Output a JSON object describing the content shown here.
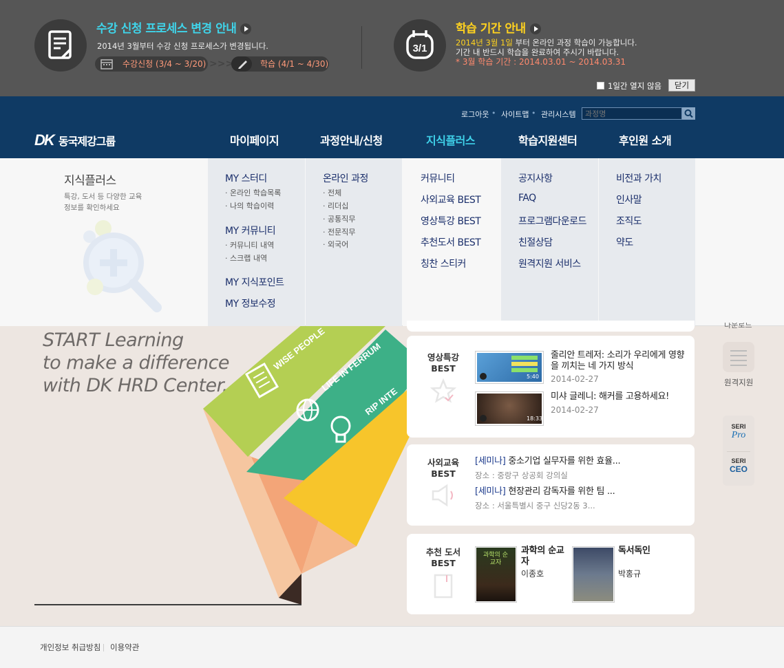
{
  "notice": {
    "left_title": "수강 신청 프로세스 변경 안내",
    "left_desc": "2014년 3월부터 수강 신청 프로세스가 변경됩니다.",
    "step1": "수강신청 (3/4 ~ 3/20)",
    "step2": "학습 (4/1 ~ 4/30)",
    "right_title": "학습 기간 안내",
    "right_highlight": "2014년 3월 1일",
    "right_desc1_rest": " 부터 온라인 과정 학습이 가능합니다.",
    "right_desc2": "기간 내 반드시 학습을 완료하여 주시기 바랍니다.",
    "right_period": "* 3월 학습 기간 : 2014.03.01 ~ 2014.03.31",
    "calendar_text": "3/1",
    "dismiss_label": "1일간 열지 않음",
    "close_label": "닫기"
  },
  "header": {
    "logo_mark": "DK",
    "logo_text": "동국제강그룹",
    "util": [
      "로그아웃",
      "사이트맵",
      "관리시스템"
    ],
    "search_placeholder": "과정명",
    "gnb": [
      "마이페이지",
      "과정안내/신청",
      "지식플러스",
      "학습지원센터",
      "후인원 소개"
    ],
    "active_index": 2
  },
  "mega": {
    "intro_title": "지식플러스",
    "intro_desc1": "특강, 도서 등 다양한 교육",
    "intro_desc2": "정보를 확인하세요",
    "col1": {
      "h1": "MY 스터디",
      "s1": [
        "온라인 학습목록",
        "나의 학습이력"
      ],
      "h2": "MY 커뮤니티",
      "s2": [
        "커뮤니티 내역",
        "스크랩 내역"
      ],
      "h3": "MY 지식포인트",
      "h4": "MY 정보수정"
    },
    "col2": {
      "h1": "온라인 과정",
      "s1": [
        "전체",
        "리더십",
        "공통직무",
        "전문직무",
        "외국어"
      ]
    },
    "col3": [
      "커뮤니티",
      "사외교육 BEST",
      "영상특강 BEST",
      "추천도서 BEST",
      "칭찬 스티커"
    ],
    "col4": [
      "공지사항",
      "FAQ",
      "프로그램다운로드",
      "친절상담",
      "원격지원 서비스"
    ],
    "col5": [
      "비전과 가치",
      "인사말",
      "조직도",
      "약도"
    ]
  },
  "hero": {
    "line1": "START Learning",
    "line2": "to make a difference",
    "line3": "with DK HRD Center.",
    "band1": "WISE PEOPLE",
    "band2": "LIFE IN FERRUM",
    "band3": "RIP INTE"
  },
  "video": {
    "label": "영상특강\nBEST",
    "items": [
      {
        "title": "줄리안 트레저: 소리가 우리에게 영향을 끼치는 네 가지 방식",
        "date": "2014-02-27",
        "duration": "5:40"
      },
      {
        "title": "미샤 글레니: 해커를 고용하세요!",
        "date": "2014-02-27",
        "duration": "18:33"
      }
    ]
  },
  "edu": {
    "label": "사외교육\nBEST",
    "items": [
      {
        "tag": "[세미나]",
        "title": " 중소기업 실무자를 위한 효율...",
        "place": "장소 : 중랑구 상공회 강의실"
      },
      {
        "tag": "[세미나]",
        "title": " 현장관리 감독자를 위한 팀 ...",
        "place": "장소 : 서울특별시 중구 신당2동 3..."
      }
    ]
  },
  "books": {
    "label": "추천 도서\nBEST",
    "items": [
      {
        "title": "과학의 순교자",
        "author": "이종호",
        "cover_text": "과학의 순교자"
      },
      {
        "title": "독서독인",
        "author": "박홍규"
      }
    ]
  },
  "side": {
    "remote_label": "원격지원",
    "top_label": "다운로드",
    "seri_pro": "Pro",
    "seri_ceo": "CEO",
    "seri": "SERI"
  },
  "footer": {
    "links": [
      "개인정보 취급방침",
      "이용약관"
    ]
  },
  "colors": {
    "header": "#0f3a64",
    "active_menu": "#3fd0e8",
    "notice_bg": "#565656",
    "accent_yellow": "#ffd21f",
    "accent_cyan": "#34c7df"
  }
}
